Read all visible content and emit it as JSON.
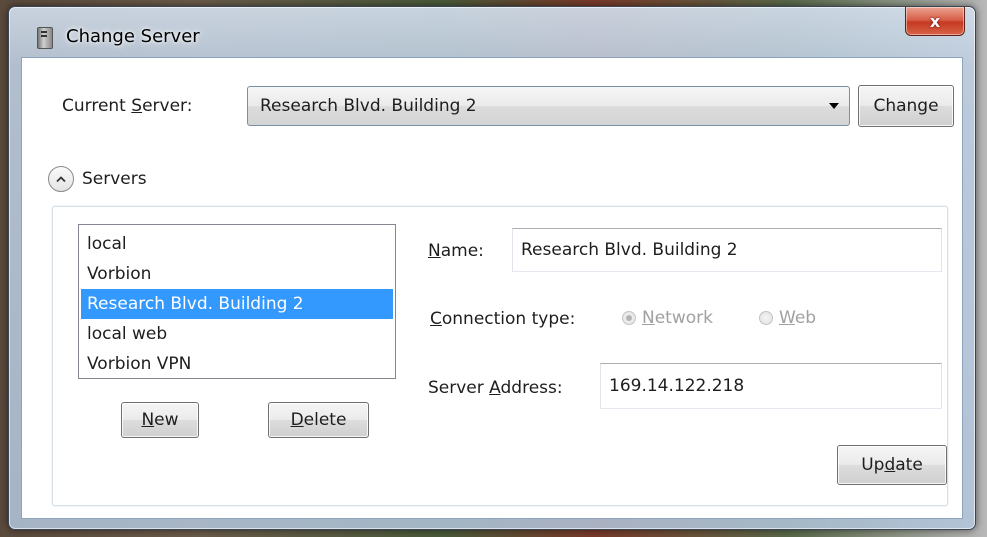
{
  "window": {
    "title": "Change Server",
    "close_glyph": "x"
  },
  "current_server": {
    "label_pre": "Current ",
    "label_key": "S",
    "label_post": "erver:",
    "value": "Research Blvd. Building 2",
    "change_button": "Change"
  },
  "servers_section": {
    "label": "Servers",
    "items": [
      {
        "label": "local"
      },
      {
        "label": "Vorbion"
      },
      {
        "label": "Research Blvd. Building 2",
        "selected": true
      },
      {
        "label": "local web"
      },
      {
        "label": "Vorbion VPN"
      }
    ],
    "new_button": {
      "key": "N",
      "rest": "ew"
    },
    "delete_button": {
      "key": "D",
      "rest": "elete"
    }
  },
  "details": {
    "name_label": {
      "key": "N",
      "rest": "ame:"
    },
    "name_value": "Research Blvd. Building 2",
    "connection_type_label": {
      "pre": "",
      "key": "C",
      "rest": "onnection type:"
    },
    "radio_network": {
      "key": "N",
      "rest": "etwork",
      "checked": true
    },
    "radio_web": {
      "key": "W",
      "rest": "eb",
      "checked": false
    },
    "address_label": {
      "pre": "Server ",
      "key": "A",
      "rest": "ddress:"
    },
    "address_value": "169.14.122.218",
    "update_button": {
      "pre": "Up",
      "key": "d",
      "rest": "ate"
    }
  },
  "icons": {
    "app": "server-icon",
    "close": "close-icon",
    "dropdown": "chevron-down-icon",
    "expander": "chevron-up-icon"
  }
}
